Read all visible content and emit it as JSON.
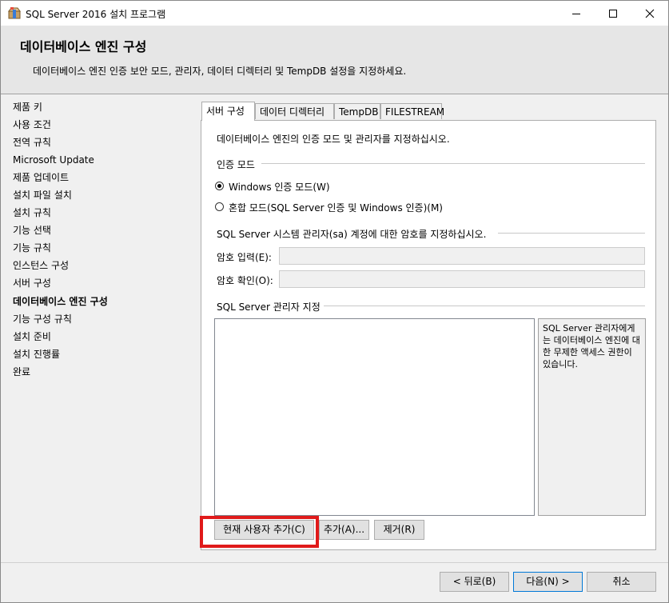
{
  "window": {
    "title": "SQL Server 2016 설치 프로그램"
  },
  "header": {
    "title": "데이터베이스 엔진 구성",
    "description": "데이터베이스 엔진 인증 보안 모드, 관리자, 데이터 디렉터리 및 TempDB 설정을 지정하세요."
  },
  "nav": {
    "items": [
      {
        "label": "제품 키"
      },
      {
        "label": "사용 조건"
      },
      {
        "label": "전역 규칙"
      },
      {
        "label": "Microsoft Update"
      },
      {
        "label": "제품 업데이트"
      },
      {
        "label": "설치 파일 설치"
      },
      {
        "label": "설치 규칙"
      },
      {
        "label": "기능 선택"
      },
      {
        "label": "기능 규칙"
      },
      {
        "label": "인스턴스 구성"
      },
      {
        "label": "서버 구성"
      },
      {
        "label": "데이터베이스 엔진 구성"
      },
      {
        "label": "기능 구성 규칙"
      },
      {
        "label": "설치 준비"
      },
      {
        "label": "설치 진행률"
      },
      {
        "label": "완료"
      }
    ],
    "active_index": 11
  },
  "tabs": [
    {
      "label": "서버 구성"
    },
    {
      "label": "데이터 디렉터리"
    },
    {
      "label": "TempDB"
    },
    {
      "label": "FILESTREAM"
    }
  ],
  "server_config": {
    "intro": "데이터베이스 엔진의 인증 모드 및 관리자를 지정하십시오.",
    "auth_mode_label": "인증 모드",
    "windows_auth_label": "Windows 인증 모드(W)",
    "mixed_mode_label": "혼합 모드(SQL Server 인증 및 Windows 인증)(M)",
    "selected_auth": "Windows 인증 모드",
    "sa_prompt": "SQL Server 시스템 관리자(sa) 계정에 대한 암호를 지정하십시오.",
    "password_label": "암호 입력(E):",
    "password_value": "",
    "confirm_label": "암호 확인(O):",
    "confirm_value": "",
    "admins_label": "SQL Server 관리자 지정",
    "admins_info": "SQL Server 관리자에게는 데이터베이스 엔진에 대한 무제한 액세스 권한이 있습니다.",
    "add_current_user_label": "현재 사용자 추가(C)",
    "add_label": "추가(A)...",
    "remove_label": "제거(R)"
  },
  "footer": {
    "back_label": "< 뒤로(B)",
    "next_label": "다음(N) >",
    "cancel_label": "취소"
  },
  "colors": {
    "highlight": "#e01a1a",
    "header_bg": "#e6e6e6",
    "window_bg": "#f0f0f0",
    "focus_border": "#0078d7"
  }
}
